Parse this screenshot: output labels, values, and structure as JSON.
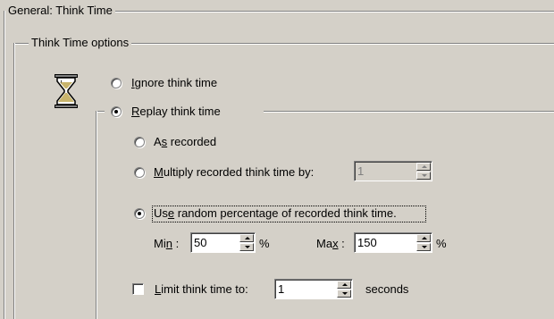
{
  "general_group": {
    "title": "General: Think Time"
  },
  "options_group": {
    "title": "Think Time options"
  },
  "ignore": {
    "label_u": "I",
    "label_rest": "gnore think time",
    "selected": false
  },
  "replay": {
    "label_u": "R",
    "label_rest": "eplay think time",
    "selected": true
  },
  "as_recorded": {
    "label_pre": "A",
    "label_u": "s",
    "label_rest": " recorded",
    "selected": false
  },
  "multiply": {
    "label_u": "M",
    "label_rest": "ultiply recorded think time by:",
    "selected": false,
    "value": "1"
  },
  "random": {
    "label_pre": "Us",
    "label_u": "e",
    "label_rest": " random percentage of recorded think time.",
    "selected": true
  },
  "min": {
    "label_pre": "Mi",
    "label_u": "n",
    "label_rest": " :",
    "value": "50",
    "unit": "%"
  },
  "max": {
    "label_pre": "Ma",
    "label_u": "x",
    "label_rest": " :",
    "value": "150",
    "unit": "%"
  },
  "limit": {
    "label_u": "L",
    "label_rest": "imit think time to:",
    "checked": false,
    "value": "1",
    "unit": "seconds"
  },
  "icon": "hourglass-icon"
}
